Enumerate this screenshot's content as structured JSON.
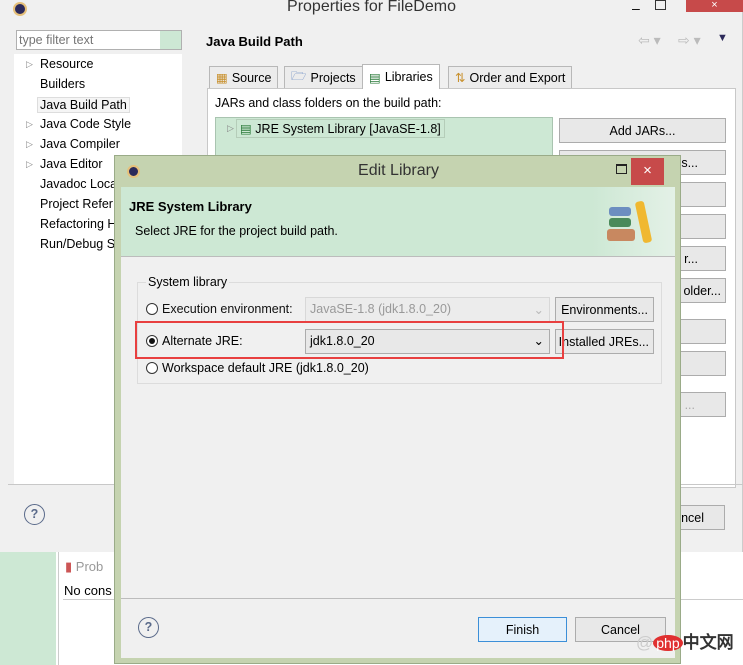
{
  "outer_window": {
    "title": "Properties for FileDemo",
    "filter_placeholder": "type filter text",
    "tree": [
      {
        "label": "Resource",
        "expandable": true
      },
      {
        "label": "Builders",
        "expandable": false
      },
      {
        "label": "Java Build Path",
        "expandable": false,
        "selected": true
      },
      {
        "label": "Java Code Style",
        "expandable": true
      },
      {
        "label": "Java Compiler",
        "expandable": true
      },
      {
        "label": "Java Editor",
        "expandable": true
      },
      {
        "label": "Javadoc Loca",
        "expandable": false
      },
      {
        "label": "Project Refer",
        "expandable": false
      },
      {
        "label": "Refactoring H",
        "expandable": false
      },
      {
        "label": "Run/Debug S",
        "expandable": false
      }
    ],
    "page_title": "Java Build Path",
    "tabs": [
      {
        "label": "Source"
      },
      {
        "label": "Projects"
      },
      {
        "label": "Libraries",
        "active": true
      },
      {
        "label": "Order and Export"
      }
    ],
    "list_caption": "JARs and class folders on the build path:",
    "list_items": [
      "JRE System Library [JavaSE-1.8]"
    ],
    "buttons": [
      "Add JARs...",
      "s...",
      "r...",
      "older...",
      "..."
    ],
    "cancel_partial": "ncel"
  },
  "workbench": {
    "problems_tab": "Prob",
    "problems_text": "No cons"
  },
  "dialog": {
    "title": "Edit Library",
    "header_title": "JRE System Library",
    "header_desc": "Select JRE for the project build path.",
    "group_label": "System library",
    "options": [
      {
        "label": "Execution environment:",
        "value": "JavaSE-1.8 (jdk1.8.0_20)",
        "button": "Environments...",
        "selected": false,
        "enabled": false
      },
      {
        "label": "Alternate JRE:",
        "value": "jdk1.8.0_20",
        "button": "Installed JREs...",
        "selected": true,
        "enabled": true
      },
      {
        "label": "Workspace default JRE (jdk1.8.0_20)",
        "selected": false
      }
    ],
    "finish": "Finish",
    "cancel": "Cancel"
  },
  "watermark": "php中文网",
  "colors": {
    "green_bg": "#cde8d4",
    "dialog_frame": "#c5d3b0",
    "highlight": "#e84040",
    "close_red": "#c74a4a"
  }
}
